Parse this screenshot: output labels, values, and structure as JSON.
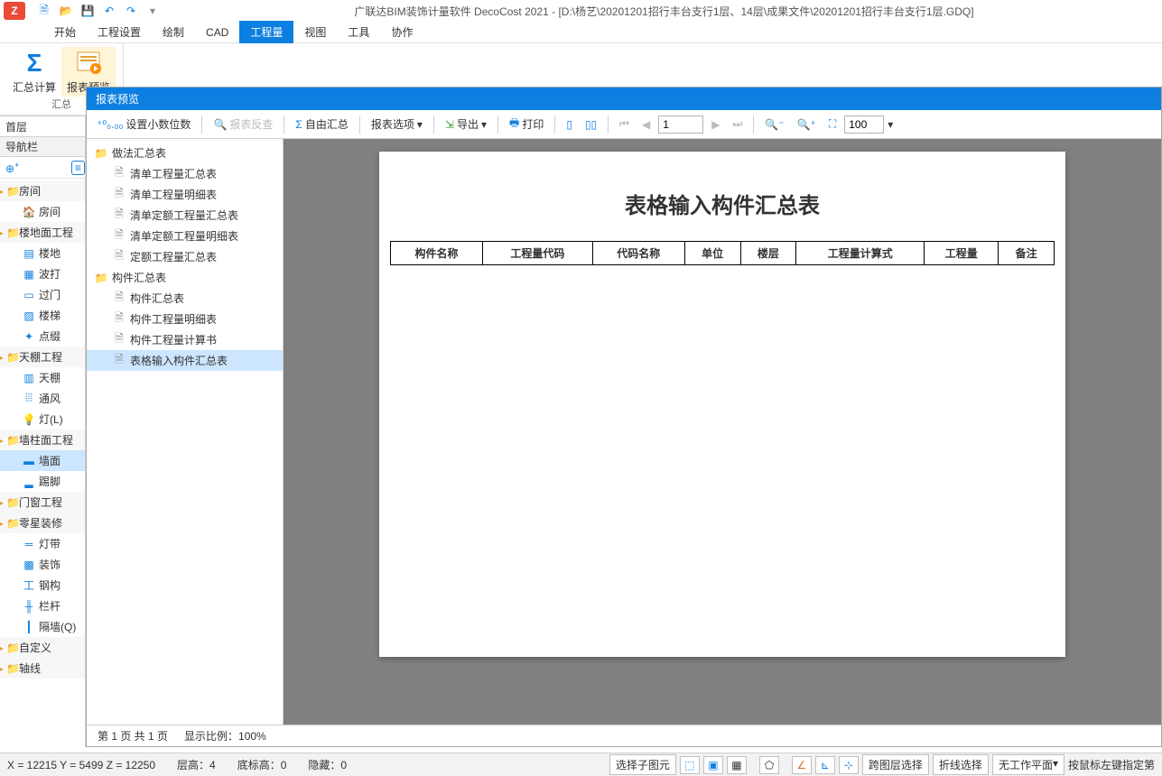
{
  "app_title": "广联达BIM装饰计量软件 DecoCost 2021 - [D:\\杨艺\\20201201招行丰台支行1层、14层\\成果文件\\20201201招行丰台支行1层.GDQ]",
  "menu_tabs": [
    "开始",
    "工程设置",
    "绘制",
    "CAD",
    "工程量",
    "视图",
    "工具",
    "协作"
  ],
  "active_tab": "工程量",
  "ribbon": {
    "calc_total": "汇总计算",
    "report_preview": "报表预览",
    "group1": "汇总"
  },
  "floor": "首层",
  "nav_header": "导航栏",
  "nav_tree": [
    {
      "type": "cat",
      "label": "房间",
      "icon": "folder"
    },
    {
      "type": "leaf",
      "label": "房间",
      "indent": 1,
      "icon": "home"
    },
    {
      "type": "cat",
      "label": "楼地面工程",
      "icon": "folder"
    },
    {
      "type": "leaf",
      "label": "楼地",
      "indent": 1,
      "icon": "floor"
    },
    {
      "type": "leaf",
      "label": "波打",
      "indent": 1,
      "icon": "wave"
    },
    {
      "type": "leaf",
      "label": "过门",
      "indent": 1,
      "icon": "door"
    },
    {
      "type": "leaf",
      "label": "楼梯",
      "indent": 1,
      "icon": "stair"
    },
    {
      "type": "leaf",
      "label": "点缀",
      "indent": 1,
      "icon": "dot"
    },
    {
      "type": "cat",
      "label": "天棚工程",
      "icon": "folder"
    },
    {
      "type": "leaf",
      "label": "天棚",
      "indent": 1,
      "icon": "ceiling"
    },
    {
      "type": "leaf",
      "label": "通风",
      "indent": 1,
      "icon": "vent"
    },
    {
      "type": "leaf",
      "label": "灯(L)",
      "indent": 1,
      "icon": "light"
    },
    {
      "type": "cat",
      "label": "墙柱面工程",
      "icon": "folder"
    },
    {
      "type": "leaf",
      "label": "墙面",
      "indent": 1,
      "icon": "wall",
      "selected": true
    },
    {
      "type": "leaf",
      "label": "踢脚",
      "indent": 1,
      "icon": "kick"
    },
    {
      "type": "cat",
      "label": "门窗工程",
      "icon": "folder"
    },
    {
      "type": "cat",
      "label": "零星装修",
      "icon": "folder"
    },
    {
      "type": "leaf",
      "label": "灯带",
      "indent": 1,
      "icon": "strip"
    },
    {
      "type": "leaf",
      "label": "装饰",
      "indent": 1,
      "icon": "deco"
    },
    {
      "type": "leaf",
      "label": "钢构",
      "indent": 1,
      "icon": "steel"
    },
    {
      "type": "leaf",
      "label": "栏杆",
      "indent": 1,
      "icon": "rail"
    },
    {
      "type": "leaf",
      "label": "隔墙(Q)",
      "indent": 1,
      "icon": "partition"
    },
    {
      "type": "cat",
      "label": "自定义",
      "icon": "folder"
    },
    {
      "type": "cat",
      "label": "轴线",
      "icon": "folder"
    }
  ],
  "preview": {
    "title": "报表预览",
    "toolbar": {
      "decimal": "设置小数位数",
      "reverse": "报表反查",
      "free_summary": "自由汇总",
      "options": "报表选项",
      "export": "导出",
      "print": "打印",
      "page_input": "1",
      "zoom_input": "100"
    },
    "tree": [
      {
        "type": "folder",
        "label": "做法汇总表"
      },
      {
        "type": "doc",
        "label": "清单工程量汇总表",
        "indent": 1
      },
      {
        "type": "doc",
        "label": "清单工程量明细表",
        "indent": 1
      },
      {
        "type": "doc",
        "label": "清单定额工程量汇总表",
        "indent": 1
      },
      {
        "type": "doc",
        "label": "清单定额工程量明细表",
        "indent": 1
      },
      {
        "type": "doc",
        "label": "定额工程量汇总表",
        "indent": 1
      },
      {
        "type": "folder",
        "label": "构件汇总表"
      },
      {
        "type": "doc",
        "label": "构件汇总表",
        "indent": 1
      },
      {
        "type": "doc",
        "label": "构件工程量明细表",
        "indent": 1
      },
      {
        "type": "doc",
        "label": "构件工程量计算书",
        "indent": 1
      },
      {
        "type": "doc",
        "label": "表格输入构件汇总表",
        "indent": 1,
        "selected": true
      }
    ],
    "page_title": "表格输入构件汇总表",
    "columns": [
      "构件名称",
      "工程量代码",
      "代码名称",
      "单位",
      "楼层",
      "工程量计算式",
      "工程量",
      "备注"
    ],
    "status": {
      "page": "第  1  页    共  1  页",
      "zoom": "显示比例：100%"
    }
  },
  "status_bar": {
    "coords": "X = 12215 Y = 5499 Z = 12250",
    "floor_h": "层高：4",
    "bottom_h": "底标高：0",
    "hidden": "隐藏：0",
    "sel_sub": "选择子图元",
    "cross_layer": "跨图层选择",
    "polyline": "折线选择",
    "work_plane": "无工作平面",
    "hint": "按鼠标左键指定第"
  }
}
